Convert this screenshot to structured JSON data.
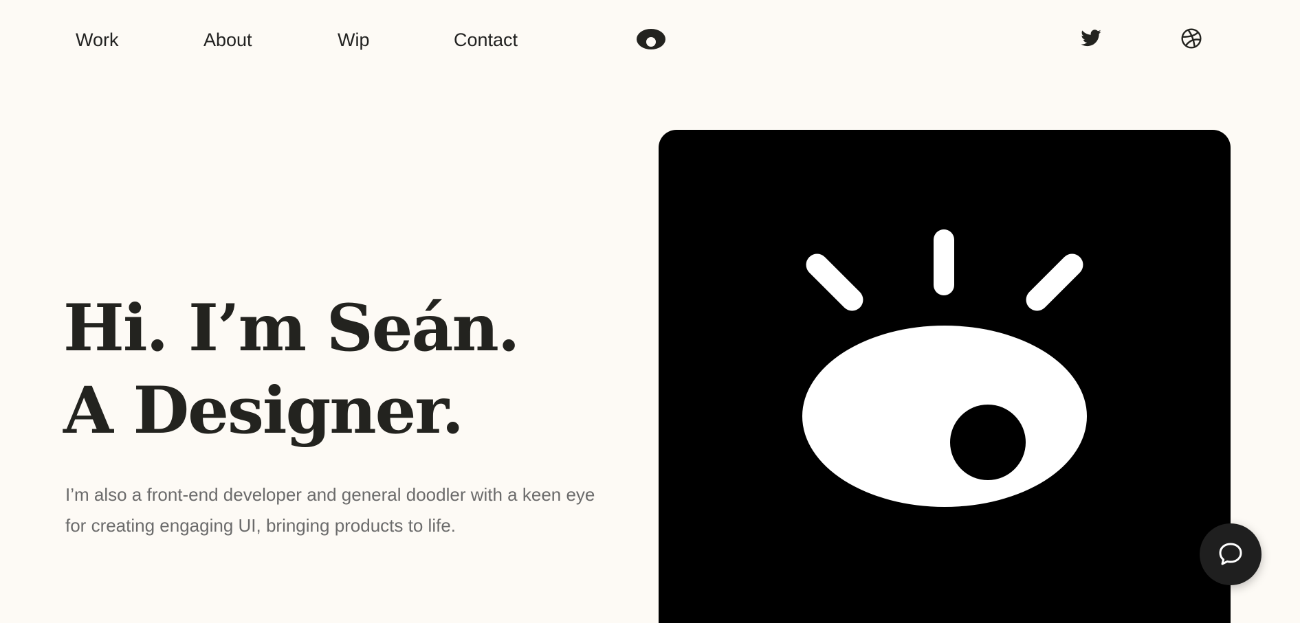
{
  "nav": {
    "items": [
      {
        "label": "Work"
      },
      {
        "label": "About"
      },
      {
        "label": "Wip"
      },
      {
        "label": "Contact"
      }
    ],
    "logo_icon": "eye-logo-icon",
    "social": [
      {
        "icon": "twitter-icon"
      },
      {
        "icon": "dribbble-icon"
      }
    ]
  },
  "hero": {
    "title_line1": "Hi. I’m Seán.",
    "title_line2": "A Designer.",
    "subtitle": "I’m also a front-end developer and general doodler with a keen eye for creating engaging UI, bringing products to life."
  },
  "art": {
    "icon": "eye-illustration-icon",
    "background": "#000000",
    "foreground": "#ffffff"
  },
  "chat": {
    "icon": "chat-bubble-icon"
  },
  "colors": {
    "background": "#fdfaf5",
    "text": "#222221",
    "muted_text": "#6b6b6b",
    "chat_button": "#1f1f1f"
  }
}
